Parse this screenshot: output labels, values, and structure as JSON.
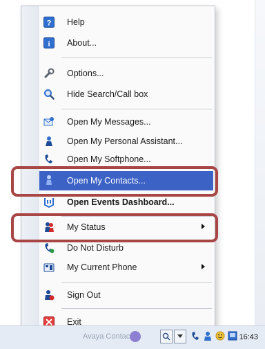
{
  "menu": {
    "items": [
      {
        "label": "Help",
        "icon": "help-icon"
      },
      {
        "label": "About...",
        "icon": "info-icon"
      },
      {
        "label": "Options...",
        "icon": "wrench-icon"
      },
      {
        "label": "Hide Search/Call box",
        "icon": "magnifier-icon"
      },
      {
        "label": "Open My Messages...",
        "icon": "messages-icon"
      },
      {
        "label": "Open My Personal Assistant...",
        "icon": "personal-assistant-icon"
      },
      {
        "label": "Open My Softphone...",
        "icon": "softphone-icon"
      },
      {
        "label": "Open My Contacts...",
        "icon": "contacts-icon",
        "selected": true
      },
      {
        "label": "Open Events Dashboard...",
        "icon": "events-dashboard-icon",
        "bold": true
      },
      {
        "label": "My Status",
        "icon": "status-icon",
        "submenu": true
      },
      {
        "label": "Do Not Disturb",
        "icon": "do-not-disturb-icon"
      },
      {
        "label": "My Current Phone",
        "icon": "current-phone-icon",
        "submenu": true
      },
      {
        "label": "Sign Out",
        "icon": "sign-out-icon"
      },
      {
        "label": "Exit",
        "icon": "exit-icon"
      }
    ]
  },
  "taskbar": {
    "search_placeholder": "Avaya Contact",
    "clock": "16:43"
  },
  "colors": {
    "selection": "#3c62c6",
    "highlight_outline": "#a84545",
    "menu_background": "#fafafa"
  }
}
